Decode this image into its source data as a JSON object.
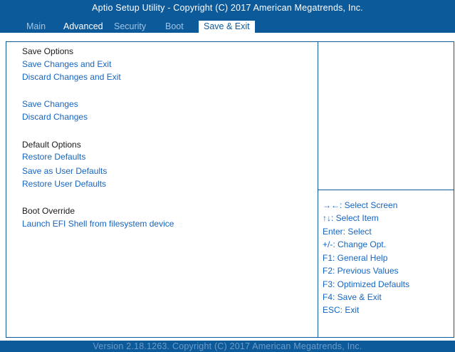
{
  "header": {
    "title": "Aptio Setup Utility - Copyright  (C)  2017 American Megatrends, Inc.",
    "tabs": [
      "Main",
      "Advanced",
      "Security",
      "Boot",
      "Save & Exit"
    ]
  },
  "content": {
    "save_options_heading": "Save Options",
    "save_changes_and_exit": "Save Changes and Exit",
    "discard_changes_and_exit": "Discard Changes and Exit",
    "save_changes": "Save Changes",
    "discard_changes": "Discard Changes",
    "default_options_heading": "Default Options",
    "restore_defaults": "Restore Defaults",
    "save_as_user_defaults": "Save as User Defaults",
    "restore_user_defaults": "Restore User Defaults",
    "boot_override_heading": "Boot Override",
    "launch_efi_shell": "Launch EFI Shell from filesystem device"
  },
  "help": [
    "→←: Select Screen",
    "↑↓: Select Item",
    "Enter: Select",
    "+/-: Change Opt.",
    "F1: General Help",
    "F2: Previous Values",
    "F3: Optimized Defaults",
    "F4: Save & Exit",
    "ESC: Exit"
  ],
  "footer": {
    "version": "Version 2.18.1263. Copyright  (C)  2017 American Megatrends, Inc."
  },
  "colors": {
    "header_bg": "#0d5a9b",
    "option_text": "#1565c0",
    "border": "#0d5a9b"
  }
}
